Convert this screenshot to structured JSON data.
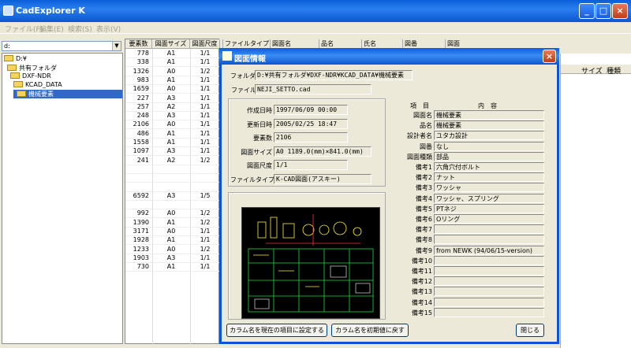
{
  "app": {
    "title": "CadExplorer K",
    "menu": [
      "ファイル(F)",
      "編集(E)",
      "検索(S)",
      "表示(V)"
    ]
  },
  "drive": {
    "value": "d:"
  },
  "tree": [
    {
      "label": "D:¥",
      "level": 0
    },
    {
      "label": "共有フォルダ",
      "level": 1
    },
    {
      "label": "DXF-NDR",
      "level": 2
    },
    {
      "label": "KCAD_DATA",
      "level": 3
    },
    {
      "label": "機械要素",
      "level": 4,
      "selected": true
    }
  ],
  "grid": {
    "headers": [
      "要素数",
      "図面サイズ",
      "図面尺度",
      "ファイルタイプ",
      "図面名",
      "品名",
      "氏名",
      "図番",
      "図面"
    ],
    "rows": [
      [
        "778",
        "A1",
        "1/1"
      ],
      [
        "338",
        "A1",
        "1/1"
      ],
      [
        "1326",
        "A0",
        "1/2"
      ],
      [
        "983",
        "A1",
        "1/1"
      ],
      [
        "1659",
        "A0",
        "1/1"
      ],
      [
        "227",
        "A3",
        "1/1"
      ],
      [
        "257",
        "A2",
        "1/1"
      ],
      [
        "248",
        "A3",
        "1/1"
      ],
      [
        "2106",
        "A0",
        "1/1"
      ],
      [
        "486",
        "A1",
        "1/1"
      ],
      [
        "1558",
        "A1",
        "1/1"
      ],
      [
        "1097",
        "A3",
        "1/1"
      ],
      [
        "241",
        "A2",
        "1/2"
      ],
      [
        "",
        "",
        ""
      ],
      [
        "",
        "",
        ""
      ],
      [
        "",
        "",
        ""
      ],
      [
        "6592",
        "A3",
        "1/5"
      ],
      [
        "",
        "",
        ""
      ],
      [
        "992",
        "A0",
        "1/2"
      ],
      [
        "1390",
        "A1",
        "1/2"
      ],
      [
        "3171",
        "A0",
        "1/1"
      ],
      [
        "1928",
        "A1",
        "1/1"
      ],
      [
        "1233",
        "A0",
        "1/2"
      ],
      [
        "1903",
        "A3",
        "1/1"
      ],
      [
        "730",
        "A1",
        "1/1"
      ]
    ]
  },
  "right_headers": {
    "size": "サイズ",
    "kind": "種類"
  },
  "dialog": {
    "title": "図面情報",
    "folder_label": "フォルダ",
    "folder": "D:¥共有フォルダ¥DXF-NDR¥KCAD_DATA¥機械要素",
    "file_label": "ファイル",
    "file": "NEJI_SETTO.cad",
    "props": [
      {
        "label": "作成日時",
        "value": "1997/06/09 00:00"
      },
      {
        "label": "更新日時",
        "value": "2005/02/25 18:47"
      },
      {
        "label": "要素数",
        "value": "2106"
      },
      {
        "label": "図面サイズ",
        "value": "A0 1189.0(mm)×841.0(mm)"
      },
      {
        "label": "図面尺度",
        "value": "1/1"
      },
      {
        "label": "ファイルタイプ",
        "value": "K-CAD図面(アスキー)"
      }
    ],
    "items_header": {
      "item": "項　目",
      "content": "内　容"
    },
    "items": [
      {
        "label": "図面名",
        "value": "機械要素"
      },
      {
        "label": "品名",
        "value": "機械要素"
      },
      {
        "label": "設計者名",
        "value": "ユタカ設計"
      },
      {
        "label": "図番",
        "value": "なし"
      },
      {
        "label": "図面種類",
        "value": "部品"
      },
      {
        "label": "備考1",
        "value": "六角穴付ボルト"
      },
      {
        "label": "備考2",
        "value": "ナット"
      },
      {
        "label": "備考3",
        "value": "ワッシャ"
      },
      {
        "label": "備考4",
        "value": "ワッシャ、スプリング"
      },
      {
        "label": "備考5",
        "value": "PTネジ"
      },
      {
        "label": "備考6",
        "value": "Oリング"
      },
      {
        "label": "備考7",
        "value": ""
      },
      {
        "label": "備考8",
        "value": ""
      },
      {
        "label": "備考9",
        "value": "from NEWK (94/06/15-version)"
      },
      {
        "label": "備考10",
        "value": ""
      },
      {
        "label": "備考11",
        "value": ""
      },
      {
        "label": "備考12",
        "value": ""
      },
      {
        "label": "備考13",
        "value": ""
      },
      {
        "label": "備考14",
        "value": ""
      },
      {
        "label": "備考15",
        "value": ""
      }
    ],
    "btn_set": "カラム名を現在の項目に設定する",
    "btn_reset": "カラム名を初期値に戻す",
    "btn_close": "閉じる"
  }
}
